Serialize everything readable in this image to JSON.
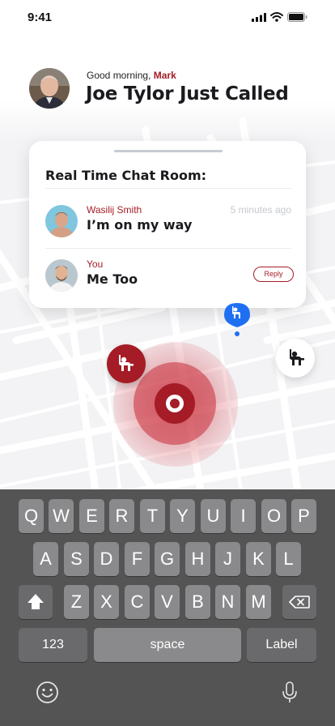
{
  "status_bar": {
    "time": "9:41"
  },
  "header": {
    "greeting_prefix": "Good morning,",
    "user_name": "Mark",
    "headline": "Joe Tylor Just Called"
  },
  "chat_card": {
    "title": "Real Time Chat Room:",
    "messages": [
      {
        "sender": "Wasilij Smith",
        "text": "I’m on my way",
        "time": "5 minutes ago"
      },
      {
        "sender": "You",
        "text": "Me Too",
        "action_label": "Reply"
      }
    ]
  },
  "colors": {
    "accent": "#a51c26",
    "blue_pin": "#1e6ff2",
    "keyboard_bg": "#4e4e4e",
    "key_bg": "#8a8a8c"
  },
  "keyboard": {
    "row1": [
      "Q",
      "W",
      "E",
      "R",
      "T",
      "Y",
      "U",
      "I",
      "O",
      "P"
    ],
    "row2": [
      "A",
      "S",
      "D",
      "F",
      "G",
      "H",
      "J",
      "K",
      "L"
    ],
    "row3": [
      "Z",
      "X",
      "C",
      "V",
      "B",
      "N",
      "M"
    ],
    "numbers_label": "123",
    "space_label": "space",
    "return_label": "Label",
    "icons": [
      "shift-icon",
      "backspace-icon",
      "emoji-icon",
      "microphone-icon"
    ]
  }
}
